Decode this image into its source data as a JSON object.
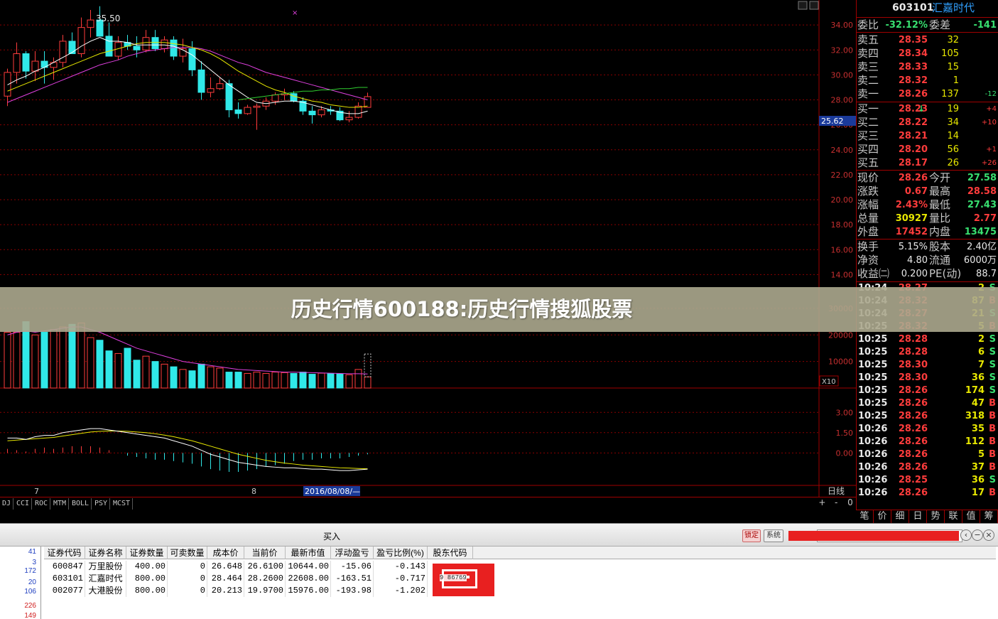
{
  "chart": {
    "ma_label": "35.50",
    "price_axis": [
      "34.00",
      "32.00",
      "30.00",
      "28.00",
      "26.00",
      "24.00",
      "22.00",
      "20.00",
      "18.00",
      "16.00",
      "14.00"
    ],
    "current_price_tag": "25.62",
    "vol_axis": [
      "30000",
      "20000",
      "10000"
    ],
    "vol_unit": "X10",
    "macd_axis": [
      "3.00",
      "1.50",
      "0.00"
    ],
    "date_labels": [
      "7",
      "8"
    ],
    "date_cursor": "2016/08/08/—",
    "period_label": "日线",
    "colors": {
      "up": "#ff3c3c",
      "down": "#30e8e8",
      "ma5": "#ffffff",
      "ma10": "#e8e800",
      "ma20": "#e040e0",
      "ma60": "#30d030",
      "grid": "#8a0000"
    }
  },
  "chart_data": {
    "type": "candlestick",
    "ohlc": [
      [
        28.3,
        30.5,
        27.5,
        30.2
      ],
      [
        30.2,
        32.6,
        29.3,
        31.7
      ],
      [
        31.7,
        31.9,
        29.7,
        30.3
      ],
      [
        30.3,
        31.9,
        29.5,
        31.1
      ],
      [
        31.1,
        31.9,
        29.3,
        30.6
      ],
      [
        30.6,
        31.4,
        29.6,
        31.0
      ],
      [
        31.0,
        33.2,
        30.6,
        32.7
      ],
      [
        32.7,
        33.4,
        31.8,
        31.7
      ],
      [
        31.7,
        34.6,
        31.4,
        33.8
      ],
      [
        33.8,
        35.2,
        33.0,
        34.4
      ],
      [
        34.4,
        35.5,
        33.8,
        33.1
      ],
      [
        33.1,
        34.2,
        31.8,
        31.5
      ],
      [
        31.5,
        33.1,
        31.2,
        32.6
      ],
      [
        32.6,
        33.2,
        32.0,
        32.3
      ],
      [
        32.3,
        33.1,
        31.4,
        32.0
      ],
      [
        32.0,
        33.6,
        31.8,
        33.0
      ],
      [
        33.0,
        33.6,
        31.9,
        32.1
      ],
      [
        32.1,
        33.1,
        31.8,
        32.8
      ],
      [
        32.8,
        33.1,
        31.2,
        31.5
      ],
      [
        31.5,
        32.9,
        31.0,
        32.1
      ],
      [
        32.1,
        32.7,
        29.9,
        30.4
      ],
      [
        30.4,
        31.1,
        28.0,
        28.6
      ],
      [
        28.6,
        29.8,
        28.2,
        28.9
      ],
      [
        28.9,
        29.8,
        28.8,
        29.3
      ],
      [
        29.3,
        29.6,
        26.6,
        27.2
      ],
      [
        27.2,
        27.8,
        26.5,
        26.9
      ],
      [
        26.9,
        27.6,
        26.8,
        27.4
      ],
      [
        27.4,
        27.7,
        25.6,
        27.5
      ],
      [
        27.5,
        28.2,
        27.2,
        27.9
      ],
      [
        27.9,
        28.6,
        27.6,
        28.4
      ],
      [
        28.4,
        28.9,
        28.0,
        28.5
      ],
      [
        28.5,
        28.7,
        27.8,
        27.9
      ],
      [
        27.9,
        28.2,
        26.8,
        27.1
      ],
      [
        27.1,
        27.5,
        26.1,
        26.8
      ],
      [
        26.8,
        27.5,
        26.6,
        27.2
      ],
      [
        27.2,
        27.5,
        26.8,
        27.1
      ],
      [
        27.1,
        27.4,
        26.3,
        26.4
      ],
      [
        26.4,
        27.1,
        26.2,
        26.6
      ],
      [
        26.6,
        27.8,
        26.5,
        27.5
      ],
      [
        27.4,
        28.58,
        27.4,
        28.26
      ]
    ],
    "ma5": [
      29.2,
      29.6,
      29.9,
      30.3,
      30.6,
      31.0,
      31.4,
      31.8,
      32.3,
      32.7,
      33.0,
      32.7,
      32.7,
      32.6,
      32.4,
      32.4,
      32.4,
      32.4,
      32.3,
      32.0,
      31.6,
      31.0,
      30.4,
      29.8,
      29.2,
      28.7,
      28.2,
      27.8,
      27.7,
      27.8,
      27.9,
      27.9,
      27.8,
      27.6,
      27.4,
      27.2,
      27.0,
      26.9,
      26.9,
      27.1
    ],
    "ma10": [
      28.7,
      29.0,
      29.3,
      29.6,
      29.9,
      30.2,
      30.5,
      30.8,
      31.1,
      31.4,
      31.7,
      31.9,
      32.1,
      32.3,
      32.5,
      32.6,
      32.6,
      32.6,
      32.5,
      32.4,
      32.2,
      32.0,
      31.7,
      31.3,
      30.8,
      30.3,
      29.9,
      29.5,
      29.1,
      28.8,
      28.6,
      28.3,
      28.1,
      27.9,
      27.8,
      27.6,
      27.5,
      27.4,
      27.4,
      27.5
    ],
    "ma20": [
      27.8,
      28.1,
      28.4,
      28.7,
      29.0,
      29.3,
      29.6,
      29.9,
      30.2,
      30.5,
      30.8,
      31.0,
      31.2,
      31.5,
      31.7,
      31.9,
      32.0,
      32.1,
      32.2,
      32.2,
      32.2,
      32.1,
      31.9,
      31.6,
      31.3,
      31.0,
      30.8,
      30.5,
      30.2,
      30.0,
      29.8,
      29.6,
      29.4,
      29.2,
      29.0,
      28.8,
      28.6,
      28.4,
      28.2,
      28.0
    ],
    "ma60": [
      null,
      null,
      null,
      null,
      null,
      null,
      null,
      null,
      null,
      null,
      null,
      null,
      null,
      null,
      null,
      null,
      null,
      null,
      null,
      null,
      null,
      null,
      null,
      null,
      null,
      28.0,
      28.1,
      28.2,
      28.3,
      28.4,
      28.5,
      28.6,
      28.7,
      28.7,
      28.8,
      28.8,
      28.9,
      28.9,
      29.0,
      29.0
    ],
    "volume": [
      21000,
      21000,
      25000,
      20000,
      21000,
      22000,
      23000,
      24000,
      24500,
      19000,
      18000,
      14000,
      13000,
      15000,
      10500,
      12000,
      10000,
      9000,
      8000,
      7000,
      6500,
      9000,
      8000,
      7500,
      6000,
      6000,
      5500,
      6000,
      5500,
      6000,
      5800,
      5500,
      6000,
      5200,
      5600,
      5400,
      5300,
      5000,
      7000,
      4200
    ],
    "volume_ma": [
      20000,
      21000,
      21500,
      21000,
      21500,
      22000,
      22500,
      23000,
      23000,
      22000,
      21000,
      19500,
      18000,
      16500,
      15000,
      14000,
      13000,
      12000,
      11000,
      10000,
      9500,
      9000,
      8500,
      8000,
      7500,
      7000,
      6800,
      6600,
      6400,
      6200,
      6000,
      6000,
      5900,
      5800,
      5700,
      5600,
      5500,
      5400,
      5400,
      5300
    ],
    "macd": [
      1.1,
      1.1,
      1.0,
      1.2,
      1.3,
      1.3,
      1.5,
      1.6,
      1.7,
      1.8,
      1.8,
      1.7,
      1.6,
      1.5,
      1.4,
      1.3,
      1.2,
      1.1,
      0.9,
      0.7,
      0.5,
      0.2,
      -0.1,
      -0.3,
      -0.5,
      -0.7,
      -0.8,
      -0.9,
      -1.0,
      -1.05,
      -1.1,
      -1.1,
      -1.15,
      -1.2,
      -1.2,
      -1.25,
      -1.3,
      -1.3,
      -1.25,
      -1.2
    ],
    "signal": [
      0.9,
      0.95,
      1.0,
      1.05,
      1.1,
      1.15,
      1.25,
      1.35,
      1.45,
      1.55,
      1.6,
      1.62,
      1.62,
      1.6,
      1.55,
      1.5,
      1.42,
      1.32,
      1.2,
      1.05,
      0.9,
      0.7,
      0.5,
      0.3,
      0.1,
      -0.1,
      -0.25,
      -0.4,
      -0.55,
      -0.65,
      -0.75,
      -0.82,
      -0.9,
      -0.95,
      -1.0,
      -1.05,
      -1.1,
      -1.12,
      -1.15,
      -1.17
    ],
    "hist": [
      0.3,
      0.2,
      0.1,
      0.3,
      0.4,
      0.3,
      0.4,
      0.5,
      0.5,
      0.5,
      0.4,
      0.2,
      0.0,
      -0.2,
      -0.3,
      -0.4,
      -0.5,
      -0.5,
      -0.6,
      -0.7,
      -0.8,
      -1.0,
      -1.2,
      -1.3,
      -1.4,
      -1.4,
      -1.3,
      -1.2,
      -1.0,
      -0.9,
      -0.8,
      -0.6,
      -0.5,
      -0.5,
      -0.4,
      -0.4,
      -0.4,
      -0.3,
      -0.2,
      -0.1
    ],
    "price_range": [
      13.0,
      36.0
    ],
    "volume_range": [
      0,
      38000
    ],
    "macd_range": [
      -2.4,
      4.8
    ]
  },
  "quote": {
    "code": "603101",
    "name": "汇嘉时代",
    "weibi_label": "委比",
    "weibi": "-32.12%",
    "weicha_label": "委差",
    "weicha": "-141",
    "asks": [
      {
        "label": "卖五",
        "price": "28.35",
        "vol": "32",
        "chg": ""
      },
      {
        "label": "卖四",
        "price": "28.34",
        "vol": "105",
        "chg": ""
      },
      {
        "label": "卖三",
        "price": "28.33",
        "vol": "15",
        "chg": ""
      },
      {
        "label": "卖二",
        "price": "28.32",
        "vol": "1",
        "chg": ""
      },
      {
        "label": "卖一",
        "price": "28.26",
        "vol": "137",
        "chg": "-12"
      }
    ],
    "bids": [
      {
        "label": "买一",
        "price": "28.23",
        "vol": "19",
        "chg": "+4",
        "arrow": "↓"
      },
      {
        "label": "买二",
        "price": "28.22",
        "vol": "34",
        "chg": "+10",
        "arrow": ""
      },
      {
        "label": "买三",
        "price": "28.21",
        "vol": "14",
        "chg": "",
        "arrow": ""
      },
      {
        "label": "买四",
        "price": "28.20",
        "vol": "56",
        "chg": "+1",
        "arrow": ""
      },
      {
        "label": "买五",
        "price": "28.17",
        "vol": "26",
        "chg": "+26",
        "arrow": ""
      }
    ],
    "stats": [
      {
        "l1": "现价",
        "v1": "28.26",
        "c1": "red",
        "l2": "今开",
        "v2": "27.58",
        "c2": "green"
      },
      {
        "l1": "涨跌",
        "v1": "0.67",
        "c1": "red",
        "l2": "最高",
        "v2": "28.58",
        "c2": "red"
      },
      {
        "l1": "涨幅",
        "v1": "2.43%",
        "c1": "red",
        "l2": "最低",
        "v2": "27.43",
        "c2": "green"
      },
      {
        "l1": "总量",
        "v1": "30927",
        "c1": "yellow",
        "l2": "量比",
        "v2": "2.77",
        "c2": "red"
      },
      {
        "l1": "外盘",
        "v1": "17452",
        "c1": "red",
        "l2": "内盘",
        "v2": "13475",
        "c2": "green"
      }
    ],
    "stats2": [
      {
        "l1": "换手",
        "v1": "5.15%",
        "l2": "股本",
        "v2": "2.40亿"
      },
      {
        "l1": "净资",
        "v1": "4.80",
        "l2": "流通",
        "v2": "6000万"
      },
      {
        "l1": "收益㈡",
        "v1": "0.200",
        "l2": "PE(动)",
        "v2": "88.7"
      }
    ],
    "ticks": [
      {
        "time": "10:24",
        "price": "28.27",
        "vol": "2",
        "bs": "S"
      },
      {
        "time": "10:24",
        "price": "28.32",
        "vol": "87",
        "bs": "B"
      },
      {
        "time": "10:24",
        "price": "28.27",
        "vol": "21",
        "bs": "S"
      },
      {
        "time": "10:25",
        "price": "28.32",
        "vol": "5",
        "bs": "B"
      },
      {
        "time": "10:25",
        "price": "28.28",
        "vol": "2",
        "bs": "S"
      },
      {
        "time": "10:25",
        "price": "28.28",
        "vol": "6",
        "bs": "S"
      },
      {
        "time": "10:25",
        "price": "28.30",
        "vol": "7",
        "bs": "S"
      },
      {
        "time": "10:25",
        "price": "28.30",
        "vol": "36",
        "bs": "S"
      },
      {
        "time": "10:25",
        "price": "28.26",
        "vol": "174",
        "bs": "S"
      },
      {
        "time": "10:25",
        "price": "28.26",
        "vol": "47",
        "bs": "B"
      },
      {
        "time": "10:25",
        "price": "28.26",
        "vol": "318",
        "bs": "B"
      },
      {
        "time": "10:26",
        "price": "28.26",
        "vol": "35",
        "bs": "B"
      },
      {
        "time": "10:26",
        "price": "28.26",
        "vol": "112",
        "bs": "B"
      },
      {
        "time": "10:26",
        "price": "28.26",
        "vol": "5",
        "bs": "B"
      },
      {
        "time": "10:26",
        "price": "28.26",
        "vol": "37",
        "bs": "B"
      },
      {
        "time": "10:26",
        "price": "28.25",
        "vol": "36",
        "bs": "S"
      },
      {
        "time": "10:26",
        "price": "28.26",
        "vol": "17",
        "bs": "B"
      }
    ],
    "tabs": [
      "笔",
      "价",
      "细",
      "日",
      "势",
      "联",
      "值",
      "筹"
    ]
  },
  "indicators": [
    "DJ",
    "CCI",
    "ROC",
    "MTM",
    "BOLL",
    "PSY",
    "MCST"
  ],
  "ind_nav": [
    "+",
    "-",
    "0"
  ],
  "banner": {
    "title": "历史行情600188:历史行情搜狐股票"
  },
  "trade": {
    "title": "买入",
    "btn_lock": "锁定",
    "btn_sys": "系统",
    "win_controls": [
      "‹",
      "−",
      "×"
    ],
    "left_numbers": [
      "41",
      "3",
      "172",
      "20",
      "106",
      "226",
      "149"
    ],
    "headers": [
      "证券代码",
      "证券名称",
      "证券数量",
      "可卖数量",
      "成本价",
      "当前价",
      "最新市值",
      "浮动盈亏",
      "盈亏比例(%)",
      "股东代码"
    ],
    "rows": [
      [
        "600847",
        "万里股份",
        "400.00",
        "0",
        "26.648",
        "26.6100",
        "10644.00",
        "-15.06",
        "-0.143",
        ""
      ],
      [
        "603101",
        "汇嘉时代",
        "800.00",
        "0",
        "28.464",
        "28.2600",
        "22608.00",
        "-163.51",
        "-0.717",
        "9 86769"
      ],
      [
        "002077",
        "大港股份",
        "800.00",
        "0",
        "20.213",
        "19.9700",
        "15976.00",
        "-193.98",
        "-1.202",
        ""
      ]
    ]
  }
}
